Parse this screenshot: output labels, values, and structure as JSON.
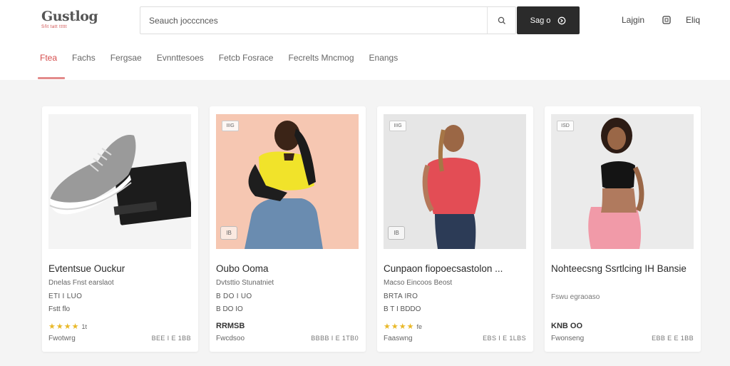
{
  "brand": {
    "logo_text": "Gustlog",
    "tagline": "Sñt tatt ttttt"
  },
  "search": {
    "placeholder": "Seauch jocccnces",
    "button_label": "Sag o"
  },
  "header_actions": {
    "login_label": "Lajgin",
    "help_label": "Eliq"
  },
  "nav": {
    "items": [
      {
        "label": "Ftea",
        "active": true
      },
      {
        "label": "Fachs",
        "active": false
      },
      {
        "label": "Fergsae",
        "active": false
      },
      {
        "label": "Evnnttesoes",
        "active": false
      },
      {
        "label": "Fetcb Fosrace",
        "active": false
      },
      {
        "label": "Fecrelts Mncmog",
        "active": false
      },
      {
        "label": "Enangs",
        "active": false
      }
    ]
  },
  "products": [
    {
      "title": "Evtentsue Ouckur",
      "subtitle": "Dnelas Fnst earslaot",
      "sku": "ETI I LUO",
      "ship": "Fstt flo",
      "rating_text": "1t",
      "stars": 4,
      "seller": "Fwotwrg",
      "meta": "BEE I E 1BB",
      "price": "",
      "tag": "",
      "badge": "",
      "image": "sneaker",
      "accent": "#f1f1f1"
    },
    {
      "title": "Oubo Ooma",
      "subtitle": "Dvtsttio Stunatniet",
      "sku": "B DO I UO",
      "ship": "B DO IO",
      "rating_text": "",
      "stars": 0,
      "price": "RRMSB",
      "seller": "Fwcdsoo",
      "meta": "BBBB I E 1TB0",
      "tag": "IIIG",
      "badge": "IB",
      "image": "woman-yellow",
      "accent": "#f4c2ad"
    },
    {
      "title": "Cunpaon fiopoecsastolon ...",
      "subtitle": "Macso Eincoos Beost",
      "sku": "BRTA IRO",
      "ship": "B T I BDDO",
      "rating_text": "fe",
      "stars": 4,
      "price": "",
      "seller": "Faaswng",
      "meta": "EBS I E 1LBS",
      "tag": "IIIG",
      "badge": "IB",
      "image": "woman-red",
      "accent": "#e4e4e4"
    },
    {
      "title": "Nohteecsng Ssrtlcing IH Bansie",
      "subtitle": "",
      "sku": "",
      "ship": "",
      "rating_text": "",
      "stars": 0,
      "desc": "Fswu egraoaso",
      "price": "KNB OO",
      "seller": "Fwonseng",
      "meta": "EBB E E 1BB",
      "tag": "ISD",
      "badge": "",
      "image": "woman-black",
      "accent": "#e9e9e9"
    }
  ],
  "colors": {
    "accent": "#d54b4b",
    "button_dark": "#2b2b2b",
    "star": "#e9b828"
  }
}
